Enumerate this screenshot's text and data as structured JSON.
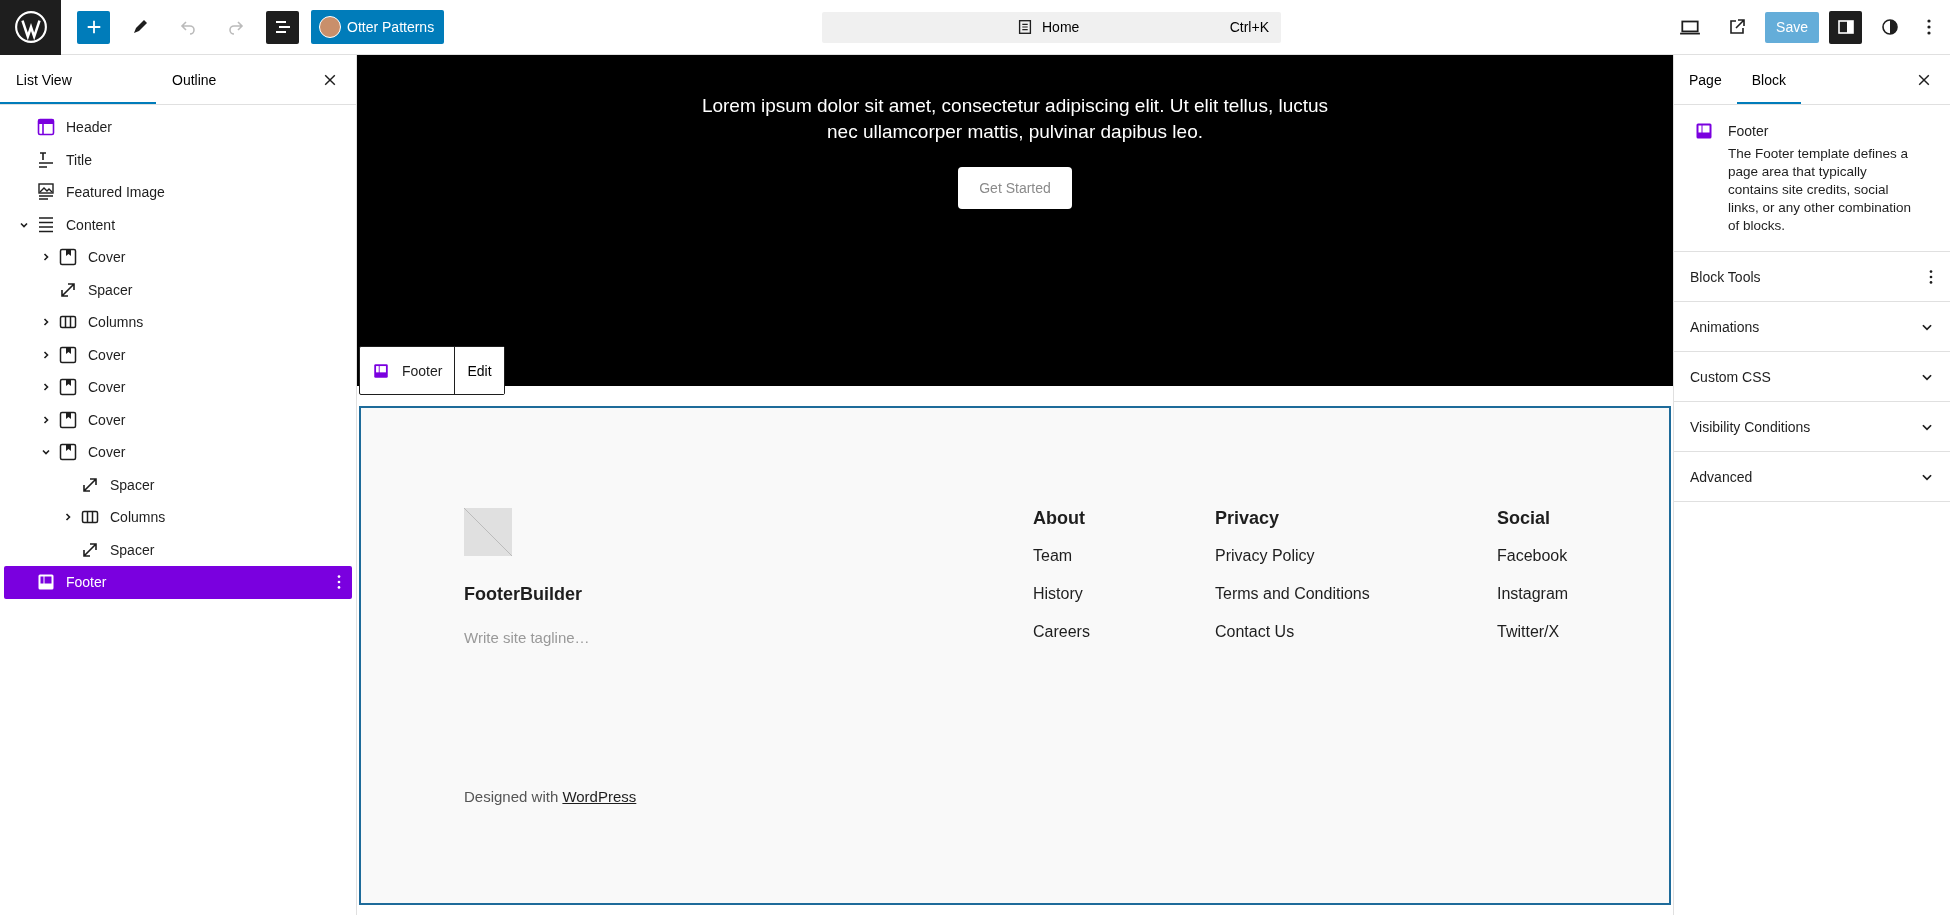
{
  "toolbar": {
    "pattern_button": "Otter Patterns",
    "document_title": "Home",
    "shortcut": "Ctrl+K",
    "save": "Save"
  },
  "list_panel": {
    "tabs": [
      {
        "label": "List View",
        "selected": true
      },
      {
        "label": "Outline",
        "selected": false
      }
    ],
    "items": [
      {
        "label": "Header",
        "kind": "header",
        "selected": false
      },
      {
        "label": "Title",
        "kind": "title",
        "selected": false
      },
      {
        "label": "Featured Image",
        "kind": "image",
        "selected": false
      },
      {
        "label": "Content",
        "kind": "content",
        "expanded": true,
        "selected": false,
        "children": [
          {
            "label": "Cover",
            "kind": "cover",
            "expanded": false,
            "selected": false
          },
          {
            "label": "Spacer",
            "kind": "spacer",
            "selected": false
          },
          {
            "label": "Columns",
            "kind": "columns",
            "expanded": false,
            "selected": false
          },
          {
            "label": "Cover",
            "kind": "cover",
            "expanded": false,
            "selected": false
          },
          {
            "label": "Cover",
            "kind": "cover",
            "expanded": false,
            "selected": false
          },
          {
            "label": "Cover",
            "kind": "cover",
            "expanded": false,
            "selected": false
          },
          {
            "label": "Cover",
            "kind": "cover",
            "expanded": true,
            "selected": false,
            "children": [
              {
                "label": "Spacer",
                "kind": "spacer",
                "selected": false
              },
              {
                "label": "Columns",
                "kind": "columns",
                "expanded": false,
                "selected": false
              },
              {
                "label": "Spacer",
                "kind": "spacer",
                "selected": false
              }
            ]
          }
        ]
      },
      {
        "label": "Footer",
        "kind": "footer",
        "selected": true
      }
    ]
  },
  "canvas": {
    "cover_text": "Lorem ipsum dolor sit amet, consectetur adipiscing elit. Ut elit tellus, luctus nec ullamcorper mattis, pulvinar dapibus leo.",
    "cover_button": "Get Started",
    "block_toolbar": {
      "label": "Footer",
      "edit": "Edit"
    },
    "footer": {
      "site_title": "FooterBuilder",
      "tagline_placeholder": "Write site tagline…",
      "columns": [
        {
          "heading": "About",
          "links": [
            "Team",
            "History",
            "Careers"
          ]
        },
        {
          "heading": "Privacy",
          "links": [
            "Privacy Policy",
            "Terms and Conditions",
            "Contact Us"
          ]
        },
        {
          "heading": "Social",
          "links": [
            "Facebook",
            "Instagram",
            "Twitter/X"
          ]
        }
      ],
      "credit_prefix": "Designed with",
      "credit_link": "WordPress"
    }
  },
  "inspector": {
    "tabs": [
      {
        "label": "Page",
        "selected": false
      },
      {
        "label": "Block",
        "selected": true
      }
    ],
    "block_name": "Footer",
    "block_description": "The Footer template defines a page area that typically contains site credits, social links, or any other combination of blocks.",
    "panels": [
      {
        "label": "Block Tools",
        "kind": "menu"
      },
      {
        "label": "Animations",
        "kind": "collapsible"
      },
      {
        "label": "Custom CSS",
        "kind": "collapsible"
      },
      {
        "label": "Visibility Conditions",
        "kind": "collapsible"
      },
      {
        "label": "Advanced",
        "kind": "collapsible"
      }
    ]
  }
}
